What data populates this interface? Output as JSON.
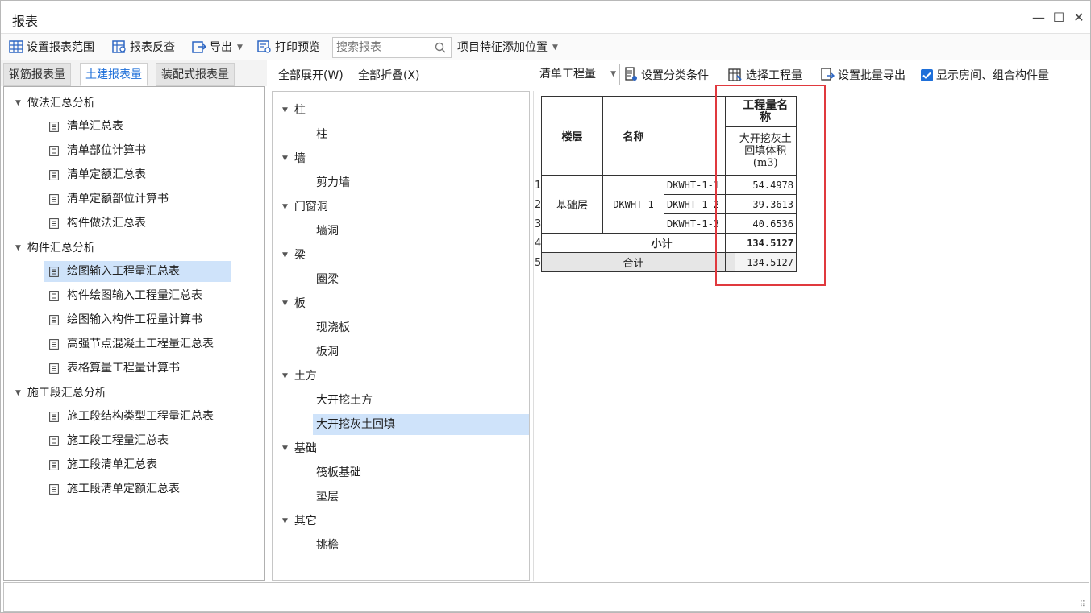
{
  "window": {
    "title": "报表",
    "minimize": "—",
    "maximize": "☐",
    "close": "✕"
  },
  "toolbar": {
    "set_range": "设置报表范围",
    "reverse": "报表反查",
    "export": "导出",
    "print_preview": "打印预览",
    "search_placeholder": "搜索报表",
    "feature_pos": "项目特征添加位置"
  },
  "left_tabs": [
    "钢筋报表量",
    "土建报表量",
    "装配式报表量"
  ],
  "tree": {
    "g1": "做法汇总分析",
    "g1_items": [
      "清单汇总表",
      "清单部位计算书",
      "清单定额汇总表",
      "清单定额部位计算书",
      "构件做法汇总表"
    ],
    "g2": "构件汇总分析",
    "g2_items": [
      "绘图输入工程量汇总表",
      "构件绘图输入工程量汇总表",
      "绘图输入构件工程量计算书",
      "高强节点混凝土工程量汇总表",
      "表格算量工程量计算书"
    ],
    "g3": "施工段汇总分析",
    "g3_items": [
      "施工段结构类型工程量汇总表",
      "施工段工程量汇总表",
      "施工段清单汇总表",
      "施工段清单定额汇总表"
    ]
  },
  "mid": {
    "expand_all": "全部展开(W)",
    "collapse_all": "全部折叠(X)",
    "groups": [
      {
        "name": "柱",
        "items": [
          "柱"
        ]
      },
      {
        "name": "墙",
        "items": [
          "剪力墙"
        ]
      },
      {
        "name": "门窗洞",
        "items": [
          "墙洞"
        ]
      },
      {
        "name": "梁",
        "items": [
          "圈梁"
        ]
      },
      {
        "name": "板",
        "items": [
          "现浇板",
          "板洞"
        ]
      },
      {
        "name": "土方",
        "items": [
          "大开挖土方",
          "大开挖灰土回填"
        ]
      },
      {
        "name": "基础",
        "items": [
          "筏板基础",
          "垫层"
        ]
      },
      {
        "name": "其它",
        "items": [
          "挑檐"
        ]
      }
    ]
  },
  "right_toolbar": {
    "combo": "清单工程量",
    "set_category": "设置分类条件",
    "select_qty": "选择工程量",
    "batch_export": "设置批量导出",
    "show_rooms": "显示房间、组合构件量"
  },
  "report": {
    "h_floor": "楼层",
    "h_name": "名称",
    "h_qty": "工程量名称",
    "h_sub": "大开挖灰土回填体积(m3)",
    "floor": "基础层",
    "name": "DKWHT-1",
    "rows": [
      {
        "code": "DKWHT-1-1",
        "val": "54.4978"
      },
      {
        "code": "DKWHT-1-2",
        "val": "39.3613"
      },
      {
        "code": "DKWHT-1-3",
        "val": "40.6536"
      }
    ],
    "subtotal_label": "小计",
    "subtotal": "134.5127",
    "total_label": "合计",
    "total": "134.5127",
    "row_numbers": [
      "1",
      "2",
      "3",
      "4",
      "5"
    ]
  }
}
